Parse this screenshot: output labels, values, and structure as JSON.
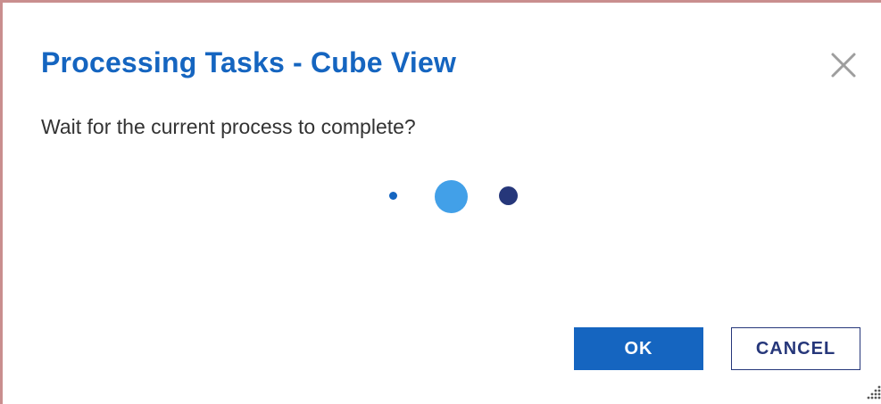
{
  "dialog": {
    "title": "Processing Tasks - Cube View",
    "message": "Wait for the current process to complete?",
    "close_icon": "close-icon",
    "loader_icon": "loading-dots-icon",
    "resize_icon": "resize-grip-icon"
  },
  "buttons": {
    "ok_label": "OK",
    "cancel_label": "CANCEL"
  },
  "colors": {
    "title": "#1565c0",
    "primary_button": "#1565c0",
    "secondary_border": "#26377a",
    "loader_dot_1": "#1565c0",
    "loader_dot_2": "#42a0e8",
    "loader_dot_3": "#26377a",
    "frame_border": "#c98e8e"
  }
}
